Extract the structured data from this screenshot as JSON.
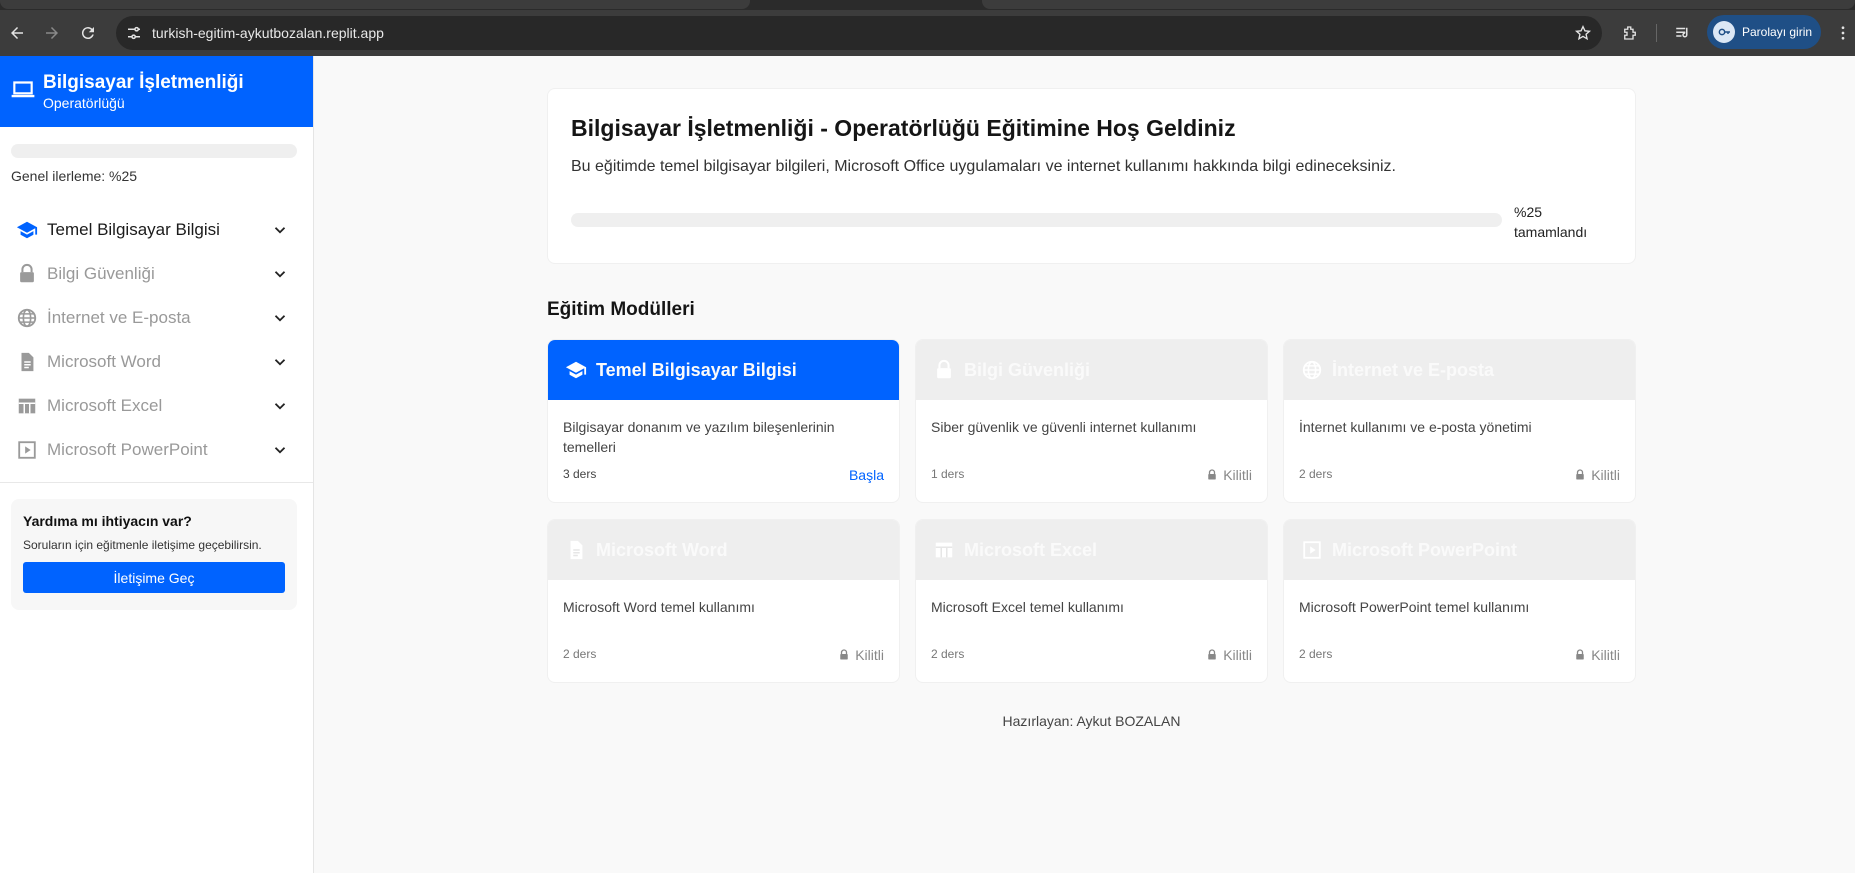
{
  "browser": {
    "url": "turkish-egitim-aykutbozalan.replit.app",
    "password_chip_label": "Parolayı girin"
  },
  "sidebar": {
    "brand_line1": "Bilgisayar İşletmenliği",
    "brand_line2": "Operatörlüğü",
    "progress_label": "Genel ilerleme: %25",
    "progress_value": 0.25,
    "items": [
      {
        "label": "Temel Bilgisayar Bilgisi",
        "icon": "graduation-cap-icon",
        "active": true
      },
      {
        "label": "Bilgi Güvenliği",
        "icon": "lock-icon",
        "active": false
      },
      {
        "label": "İnternet ve E-posta",
        "icon": "globe-icon",
        "active": false
      },
      {
        "label": "Microsoft Word",
        "icon": "document-icon",
        "active": false
      },
      {
        "label": "Microsoft Excel",
        "icon": "table-icon",
        "active": false
      },
      {
        "label": "Microsoft PowerPoint",
        "icon": "play-box-icon",
        "active": false
      }
    ],
    "help": {
      "title": "Yardıma mı ihtiyacın var?",
      "text": "Soruların için eğitmenle iletişime geçebilirsin.",
      "button": "İletişime Geç"
    }
  },
  "welcome": {
    "title": "Bilgisayar İşletmenliği - Operatörlüğü Eğitimine Hoş Geldiniz",
    "description": "Bu eğitimde temel bilgisayar bilgileri, Microsoft Office uygulamaları ve internet kullanımı hakkında bilgi edineceksiniz.",
    "progress_pct": "%25",
    "progress_word": "tamamlandı",
    "progress_value": 0.25
  },
  "modules_title": "Eğitim Modülleri",
  "modules": [
    {
      "title": "Temel Bilgisayar Bilgisi",
      "icon": "graduation-cap-icon",
      "description": "Bilgisayar donanım ve yazılım bileşenlerinin temelleri",
      "lessons": "3 ders",
      "status": "Başla",
      "active": true
    },
    {
      "title": "Bilgi Güvenliği",
      "icon": "lock-icon",
      "description": "Siber güvenlik ve güvenli internet kullanımı",
      "lessons": "1 ders",
      "status": "Kilitli",
      "active": false
    },
    {
      "title": "İnternet ve E-posta",
      "icon": "globe-icon",
      "description": "İnternet kullanımı ve e-posta yönetimi",
      "lessons": "2 ders",
      "status": "Kilitli",
      "active": false
    },
    {
      "title": "Microsoft Word",
      "icon": "document-icon",
      "description": "Microsoft Word temel kullanımı",
      "lessons": "2 ders",
      "status": "Kilitli",
      "active": false
    },
    {
      "title": "Microsoft Excel",
      "icon": "table-icon",
      "description": "Microsoft Excel temel kullanımı",
      "lessons": "2 ders",
      "status": "Kilitli",
      "active": false
    },
    {
      "title": "Microsoft PowerPoint",
      "icon": "play-box-icon",
      "description": "Microsoft PowerPoint temel kullanımı",
      "lessons": "2 ders",
      "status": "Kilitli",
      "active": false
    }
  ],
  "footer": "Hazırlayan: Aykut BOZALAN",
  "colors": {
    "accent": "#0063ff",
    "locked_header": "#eeeeee"
  }
}
